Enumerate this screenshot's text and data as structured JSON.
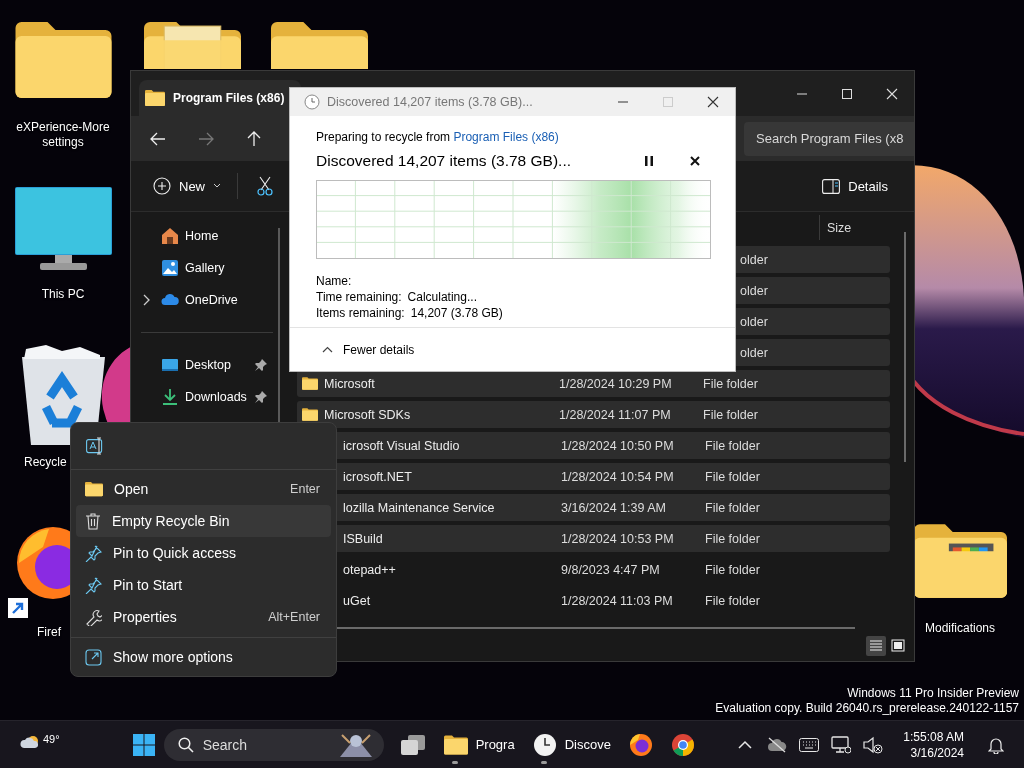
{
  "desktop_icons": [
    {
      "kind": "folder",
      "label": "eXPerience-More settings"
    },
    {
      "kind": "folder-doc"
    },
    {
      "kind": "folder"
    },
    {
      "kind": "monitor",
      "label": "This PC"
    },
    {
      "kind": "recycle-bin",
      "label": "Recycle"
    },
    {
      "kind": "firefox",
      "label": "Firef"
    },
    {
      "kind": "folder-colors",
      "label": "Modifications"
    }
  ],
  "explorer": {
    "tab": {
      "title": "Program Files (x86)"
    },
    "search": {
      "placeholder": "Search Program Files (x8"
    },
    "commands": {
      "new": "New",
      "details": "Details"
    },
    "nav": [
      {
        "kind": "home",
        "label": "Home",
        "expandable": false,
        "pinned": false
      },
      {
        "kind": "gallery",
        "label": "Gallery",
        "expandable": false,
        "pinned": false
      },
      {
        "kind": "cloud",
        "label": "OneDrive",
        "expandable": true,
        "pinned": false
      },
      {
        "kind": "divider"
      },
      {
        "kind": "desktop",
        "label": "Desktop",
        "expandable": false,
        "pinned": true
      },
      {
        "kind": "downloads",
        "label": "Downloads",
        "expandable": false,
        "pinned": true
      }
    ],
    "size_header": "Size",
    "rows": [
      {
        "kind": "type_only",
        "type": "older",
        "selected": true
      },
      {
        "kind": "type_only",
        "type": "older",
        "selected": true
      },
      {
        "kind": "type_only",
        "type": "older",
        "selected": true
      },
      {
        "kind": "type_only",
        "type": "older",
        "selected": true
      },
      {
        "kind": "full",
        "name": "Microsoft",
        "date": "1/28/2024 10:29 PM",
        "type": "File folder",
        "selected": true
      },
      {
        "kind": "full",
        "name": "Microsoft SDKs",
        "date": "1/28/2024 11:07 PM",
        "type": "File folder",
        "selected": true
      },
      {
        "kind": "partial",
        "name": "icrosoft Visual Studio",
        "date": "1/28/2024 10:50 PM",
        "type": "File folder",
        "selected": true
      },
      {
        "kind": "partial",
        "name": "icrosoft.NET",
        "date": "1/28/2024 10:54 PM",
        "type": "File folder",
        "selected": true
      },
      {
        "kind": "partial",
        "name": "lozilla Maintenance Service",
        "date": "3/16/2024 1:39 AM",
        "type": "File folder",
        "selected": true
      },
      {
        "kind": "partial",
        "name": "ISBuild",
        "date": "1/28/2024 10:53 PM",
        "type": "File folder",
        "selected": true
      },
      {
        "kind": "partial",
        "name": "otepad++",
        "date": "9/8/2023 4:47 PM",
        "type": "File folder",
        "selected": false
      },
      {
        "kind": "partial",
        "name": "uGet",
        "date": "1/28/2024 11:03 PM",
        "type": "File folder",
        "selected": false
      }
    ]
  },
  "dialog": {
    "title": "Discovered 14,207 items (3.78 GB)...",
    "window_buttons": [
      {
        "kind": "minimize",
        "disabled": false
      },
      {
        "kind": "maximize",
        "disabled": true
      },
      {
        "kind": "close",
        "disabled": false
      }
    ],
    "source_prefix": "Preparing to recycle from ",
    "source_link": "Program Files (x86)",
    "heading": "Discovered 14,207 items (3.78 GB)...",
    "details": [
      {
        "label": "Name:"
      },
      {
        "label": "Time remaining:",
        "value": "Calculating..."
      },
      {
        "label": "Items remaining:",
        "value": "14,207 (3.78 GB)"
      }
    ],
    "toggle": "Fewer details"
  },
  "context_menu": {
    "items": [
      {
        "kind": "open",
        "label": "Open",
        "shortcut": "Enter",
        "hovered": false
      },
      {
        "kind": "trash",
        "label": "Empty Recycle Bin",
        "hovered": true
      },
      {
        "kind": "pin",
        "label": "Pin to Quick access",
        "hovered": false
      },
      {
        "kind": "pin",
        "label": "Pin to Start",
        "hovered": false
      },
      {
        "kind": "wrench",
        "label": "Properties",
        "shortcut": "Alt+Enter",
        "hovered": false
      }
    ],
    "footer": {
      "kind": "more",
      "label": "Show more options"
    }
  },
  "build_notice": [
    "Windows 11 Pro Insider Preview",
    "Evaluation copy. Build 26040.rs_prerelease.240122-1157"
  ],
  "taskbar": {
    "weather": {
      "temp": "49°"
    },
    "search": {
      "placeholder": "Search"
    },
    "apps": [
      {
        "kind": "task-view",
        "running": false
      },
      {
        "kind": "explorer",
        "label": "Progra",
        "running": true
      },
      {
        "kind": "clock",
        "label": "Discove",
        "running": true
      },
      {
        "kind": "firefox",
        "running": false
      },
      {
        "kind": "chrome",
        "running": false
      }
    ],
    "tray": [
      {
        "kind": "chevron"
      },
      {
        "kind": "cloud-off"
      },
      {
        "kind": "keyboard"
      },
      {
        "kind": "network"
      },
      {
        "kind": "volume-muted"
      }
    ],
    "time": "1:55:08 AM",
    "date": "3/16/2024"
  }
}
